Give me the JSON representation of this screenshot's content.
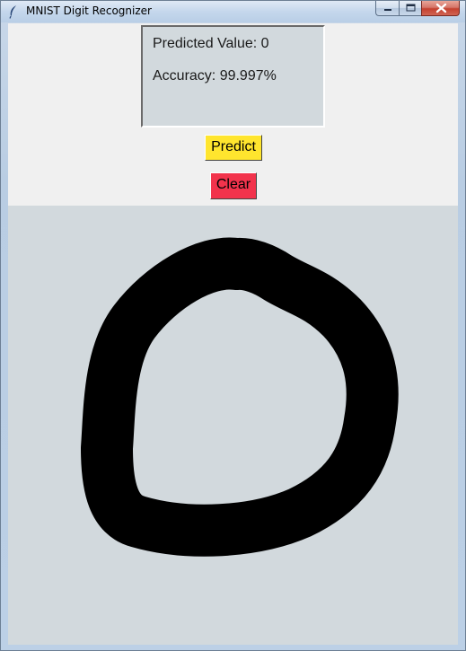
{
  "window": {
    "title": "MNIST Digit Recognizer",
    "app_icon": "feather-icon",
    "controls": {
      "minimize_icon": "minimize-icon",
      "maximize_icon": "maximize-icon",
      "close_icon": "close-icon"
    }
  },
  "result": {
    "predicted": "Predicted Value: 0",
    "accuracy": "Accuracy: 99.997%"
  },
  "buttons": {
    "predict": {
      "label": "Predict",
      "color": "#ffe52e"
    },
    "clear": {
      "label": "Clear",
      "color": "#f2334c"
    }
  },
  "canvas": {
    "background": "#d2d9dd",
    "stroke_color": "#000000"
  }
}
